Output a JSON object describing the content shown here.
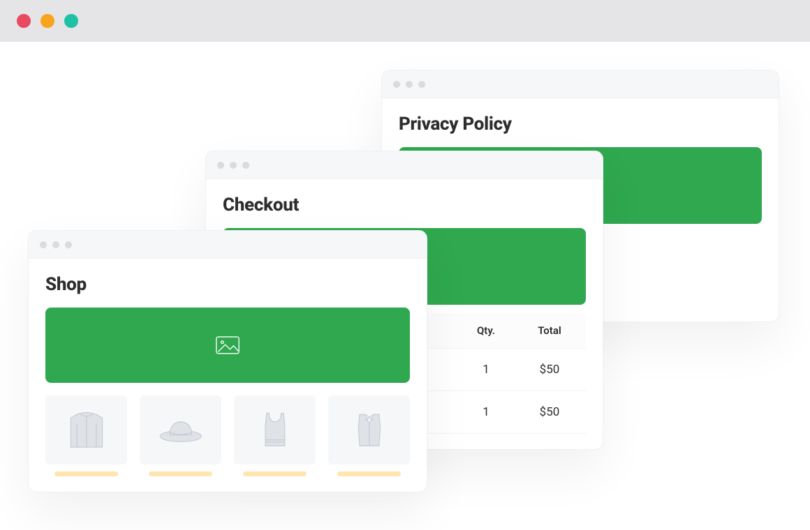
{
  "colors": {
    "accent_green": "#2fa84f",
    "accent_blue_line": "#cfe7fb",
    "price_bar": "#ffe6b0",
    "os_red": "#e84a5f",
    "os_yellow": "#f7a51c",
    "os_green": "#1fc1a5"
  },
  "windows": {
    "privacy": {
      "title": "Privacy Policy"
    },
    "checkout": {
      "title": "Checkout",
      "headers": {
        "qty": "Qty.",
        "total": "Total"
      },
      "rows": [
        {
          "qty": "1",
          "total": "$50"
        },
        {
          "qty": "1",
          "total": "$50"
        }
      ]
    },
    "shop": {
      "title": "Shop",
      "hero_icon": "image-icon",
      "products": [
        {
          "icon": "jacket-icon"
        },
        {
          "icon": "hat-icon"
        },
        {
          "icon": "tanktop-icon"
        },
        {
          "icon": "vest-icon"
        }
      ]
    }
  }
}
